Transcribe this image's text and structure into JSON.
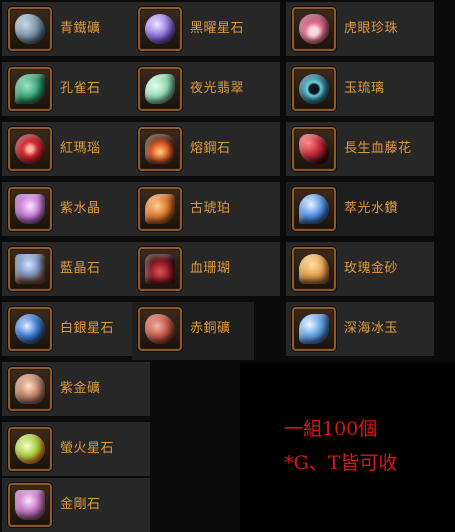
{
  "colors": {
    "label": "#e09a3c",
    "promo_text": "#d81616",
    "slot_border": "#8a5a2a"
  },
  "items": [
    {
      "name": "青鐵礦",
      "icon": "gray-ore-icon",
      "color": "#8aa3b8"
    },
    {
      "name": "黑曜星石",
      "icon": "purple-orb-icon",
      "color": "#7b5fd0"
    },
    {
      "name": "虎眼珍珠",
      "icon": "pink-shell-pearl-icon",
      "color": "#d86c8a"
    },
    {
      "name": "孔雀石",
      "icon": "green-leaf-stone-icon",
      "color": "#2f9a6a"
    },
    {
      "name": "夜光翡翠",
      "icon": "jade-claw-icon",
      "color": "#8fd6b0"
    },
    {
      "name": "玉琉璃",
      "icon": "teal-ring-icon",
      "color": "#4fb6c7"
    },
    {
      "name": "紅瑪瑙",
      "icon": "red-disc-icon",
      "color": "#c8232b"
    },
    {
      "name": "熔鋼石",
      "icon": "molten-rock-icon",
      "color": "#e0602a"
    },
    {
      "name": "長生血藤花",
      "icon": "red-vine-flower-icon",
      "color": "#c42a3a"
    },
    {
      "name": "紫水晶",
      "icon": "amethyst-cluster-icon",
      "color": "#c77ad6"
    },
    {
      "name": "古琥珀",
      "icon": "amber-leaf-icon",
      "color": "#d8742a"
    },
    {
      "name": "萃光水鑽",
      "icon": "blue-crystal-icon",
      "color": "#4f8fe0"
    },
    {
      "name": "藍晶石",
      "icon": "blue-tablet-ore-icon",
      "color": "#7a96c4"
    },
    {
      "name": "血珊瑚",
      "icon": "red-coral-icon",
      "color": "#b8262c"
    },
    {
      "name": "玫瑰金砂",
      "icon": "rose-gold-sand-icon",
      "color": "#e3a24a"
    },
    {
      "name": "白銀星石",
      "icon": "silver-star-orb-icon",
      "color": "#3f7fd6"
    },
    {
      "name": "赤銅礦",
      "icon": "copper-ore-icon",
      "color": "#c85a4a"
    },
    {
      "name": "深海冰玉",
      "icon": "deep-sea-ice-jade-icon",
      "color": "#6aa6e8"
    },
    {
      "name": "紫金礦",
      "icon": "purple-gold-ore-icon",
      "color": "#c98a6a"
    },
    {
      "name": "螢火星石",
      "icon": "firefly-star-orb-icon",
      "color": "#a6d040"
    },
    {
      "name": "金剛石",
      "icon": "diamond-ore-icon",
      "color": "#c97ac8"
    }
  ],
  "promo": {
    "line1": "一組100個",
    "line2": "*G、T皆可收"
  }
}
